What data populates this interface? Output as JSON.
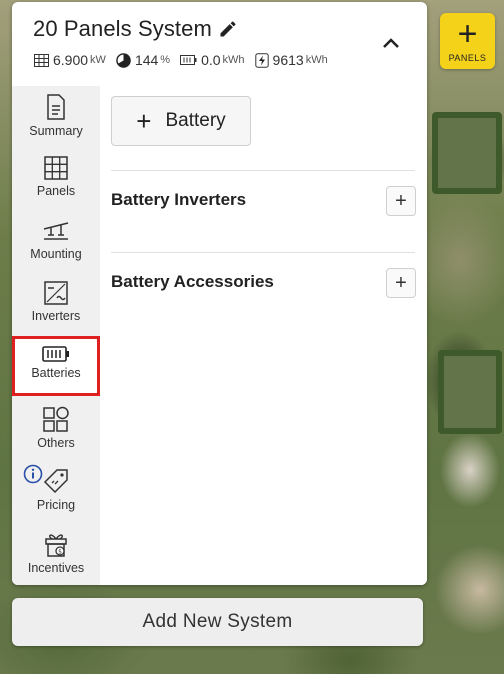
{
  "system": {
    "title": "20 Panels System",
    "stats": {
      "power_value": "6.900",
      "power_unit": "kW",
      "offset_value": "144",
      "offset_unit": "%",
      "battery_value": "0.0",
      "battery_unit": "kWh",
      "production_value": "9613",
      "production_unit": "kWh"
    }
  },
  "sidebar": {
    "items": [
      {
        "label": "Summary",
        "icon": "document-icon"
      },
      {
        "label": "Panels",
        "icon": "grid-icon"
      },
      {
        "label": "Mounting",
        "icon": "mounting-icon"
      },
      {
        "label": "Inverters",
        "icon": "inverter-icon"
      },
      {
        "label": "Batteries",
        "icon": "battery-icon",
        "active": true
      },
      {
        "label": "Others",
        "icon": "shapes-icon"
      },
      {
        "label": "Pricing",
        "icon": "price-tag-icon"
      },
      {
        "label": "Incentives",
        "icon": "gift-icon"
      }
    ]
  },
  "content": {
    "add_battery_label": "Battery",
    "sections": [
      {
        "title": "Battery Inverters"
      },
      {
        "title": "Battery Accessories"
      }
    ]
  },
  "footer": {
    "add_system_label": "Add New System"
  },
  "panels_button": {
    "label": "PANELS"
  },
  "colors": {
    "accent_yellow": "#f4d21a",
    "active_outline": "#e02020",
    "info_blue": "#2a4fa8"
  }
}
